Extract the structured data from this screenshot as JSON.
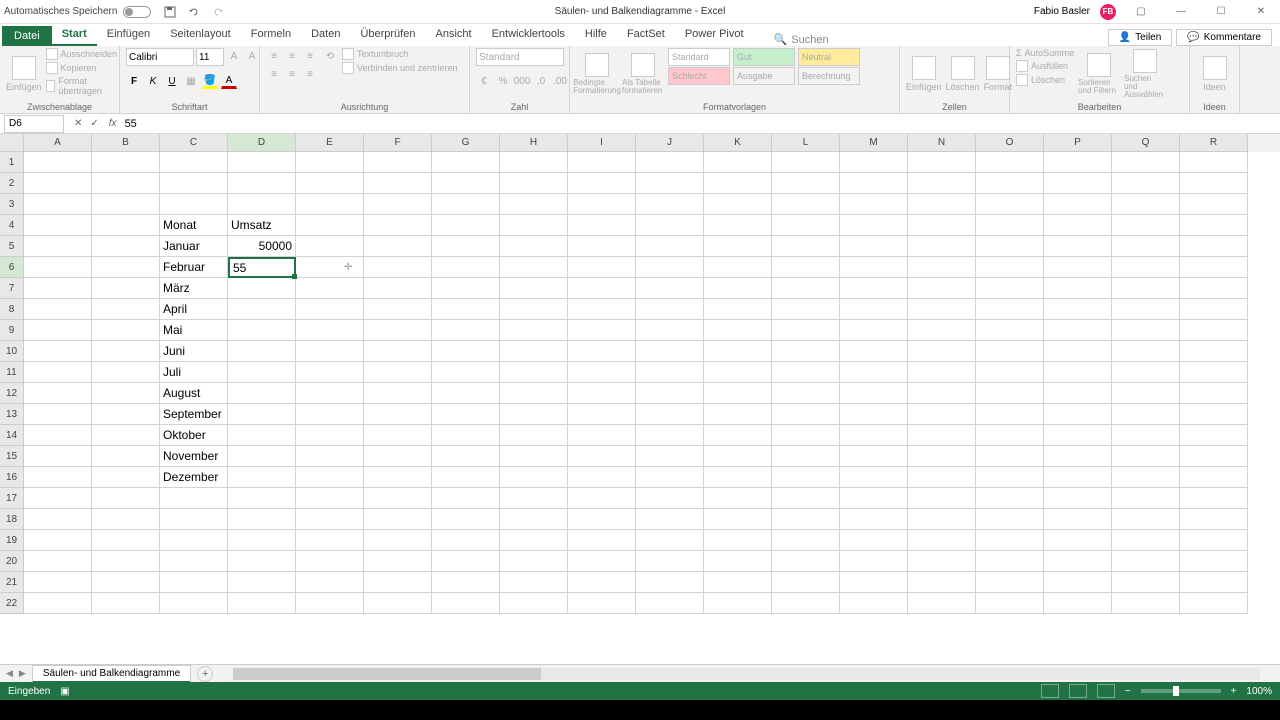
{
  "titlebar": {
    "autosave": "Automatisches Speichern",
    "doc_title": "Säulen- und Balkendiagramme - Excel",
    "user_name": "Fabio Basler",
    "user_initials": "FB"
  },
  "ribbon_tabs": {
    "file": "Datei",
    "items": [
      "Start",
      "Einfügen",
      "Seitenlayout",
      "Formeln",
      "Daten",
      "Überprüfen",
      "Ansicht",
      "Entwicklertools",
      "Hilfe",
      "FactSet",
      "Power Pivot"
    ],
    "active_index": 0,
    "search_placeholder": "Suchen",
    "share": "Teilen",
    "comments": "Kommentare"
  },
  "ribbon": {
    "clipboard": {
      "label": "Zwischenablage",
      "paste": "Einfügen",
      "cut": "Ausschneiden",
      "copy": "Kopieren",
      "format_painter": "Format übertragen"
    },
    "font": {
      "label": "Schriftart",
      "name": "Calibri",
      "size": "11"
    },
    "alignment": {
      "label": "Ausrichtung",
      "wrap": "Textumbruch",
      "merge": "Verbinden und zentrieren"
    },
    "number": {
      "label": "Zahl",
      "format": "Standard"
    },
    "styles": {
      "label": "Formatvorlagen",
      "conditional": "Bedingte Formatierung",
      "as_table": "Als Tabelle formatieren",
      "cells": [
        "Standard",
        "Gut",
        "Neutral",
        "Schlecht",
        "Ausgabe",
        "Berechnung"
      ]
    },
    "cells": {
      "label": "Zellen",
      "insert": "Einfügen",
      "delete": "Löschen",
      "format": "Format"
    },
    "editing": {
      "label": "Bearbeiten",
      "autosum": "AutoSumme",
      "fill": "Ausfüllen",
      "clear": "Löschen",
      "sort": "Sortieren und Filtern",
      "find": "Suchen und Auswählen"
    },
    "ideas": {
      "label": "Ideen",
      "btn": "Ideen"
    }
  },
  "formula_bar": {
    "name_box": "D6",
    "formula": "55"
  },
  "grid": {
    "columns": [
      "A",
      "B",
      "C",
      "D",
      "E",
      "F",
      "G",
      "H",
      "I",
      "J",
      "K",
      "L",
      "M",
      "N",
      "O",
      "P",
      "Q",
      "R"
    ],
    "row_count": 22,
    "active_col": "D",
    "active_row": 6,
    "cells": {
      "C4": "Monat",
      "D4": "Umsatz",
      "C5": "Januar",
      "D5": "50000",
      "C6": "Februar",
      "D6": "55",
      "C7": "März",
      "C8": "April",
      "C9": "Mai",
      "C10": "Juni",
      "C11": "Juli",
      "C12": "August",
      "C13": "September",
      "C14": "Oktober",
      "C15": "November",
      "C16": "Dezember"
    }
  },
  "sheet_bar": {
    "active_sheet": "Säulen- und Balkendiagramme"
  },
  "status_bar": {
    "mode": "Eingeben",
    "zoom": "100%"
  }
}
